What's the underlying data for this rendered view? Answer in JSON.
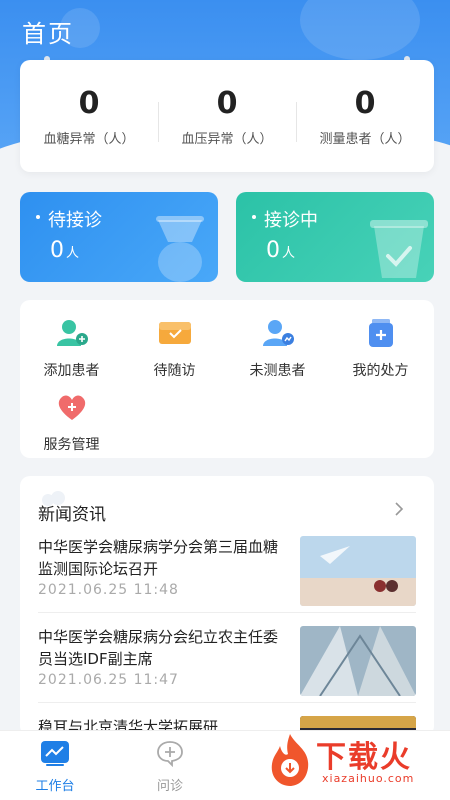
{
  "header": {
    "title": "首页"
  },
  "stats": [
    {
      "value": "0",
      "label": "血糖异常（人）"
    },
    {
      "value": "0",
      "label": "血压异常（人）"
    },
    {
      "value": "0",
      "label": "测量患者（人）"
    }
  ],
  "status_cards": [
    {
      "title": "待接诊",
      "count": "0",
      "unit": "人"
    },
    {
      "title": "接诊中",
      "count": "0",
      "unit": "人"
    }
  ],
  "quick_actions": [
    {
      "label": "添加患者",
      "icon": "add-patient-icon"
    },
    {
      "label": "待随访",
      "icon": "followup-icon"
    },
    {
      "label": "未测患者",
      "icon": "unmeasured-patient-icon"
    },
    {
      "label": "我的处方",
      "icon": "prescription-icon"
    },
    {
      "label": "服务管理",
      "icon": "service-heart-icon"
    }
  ],
  "news": {
    "header": "新闻资讯",
    "items": [
      {
        "title": "中华医学会糖尿病学分会第三届血糖监测国际论坛召开",
        "date": "2021.06.25 11:48"
      },
      {
        "title": "中华医学会糖尿病分会纪立农主任委员当选IDF副主席",
        "date": "2021.06.25 11:47"
      },
      {
        "title": "稳耳与北京清华大学拓展研",
        "date": ""
      }
    ]
  },
  "tabbar": {
    "items": [
      {
        "label": "工作台",
        "active": true
      },
      {
        "label": "问诊",
        "active": false
      }
    ],
    "active_color": "#1f7fe6",
    "inactive_color": "#999999"
  },
  "watermark": {
    "text": "下载火",
    "url": "xiazaihuo.com"
  },
  "colors": {
    "primary": "#3b8ff0",
    "green": "#2bc2a7",
    "brand_red": "#ea3c2a"
  }
}
